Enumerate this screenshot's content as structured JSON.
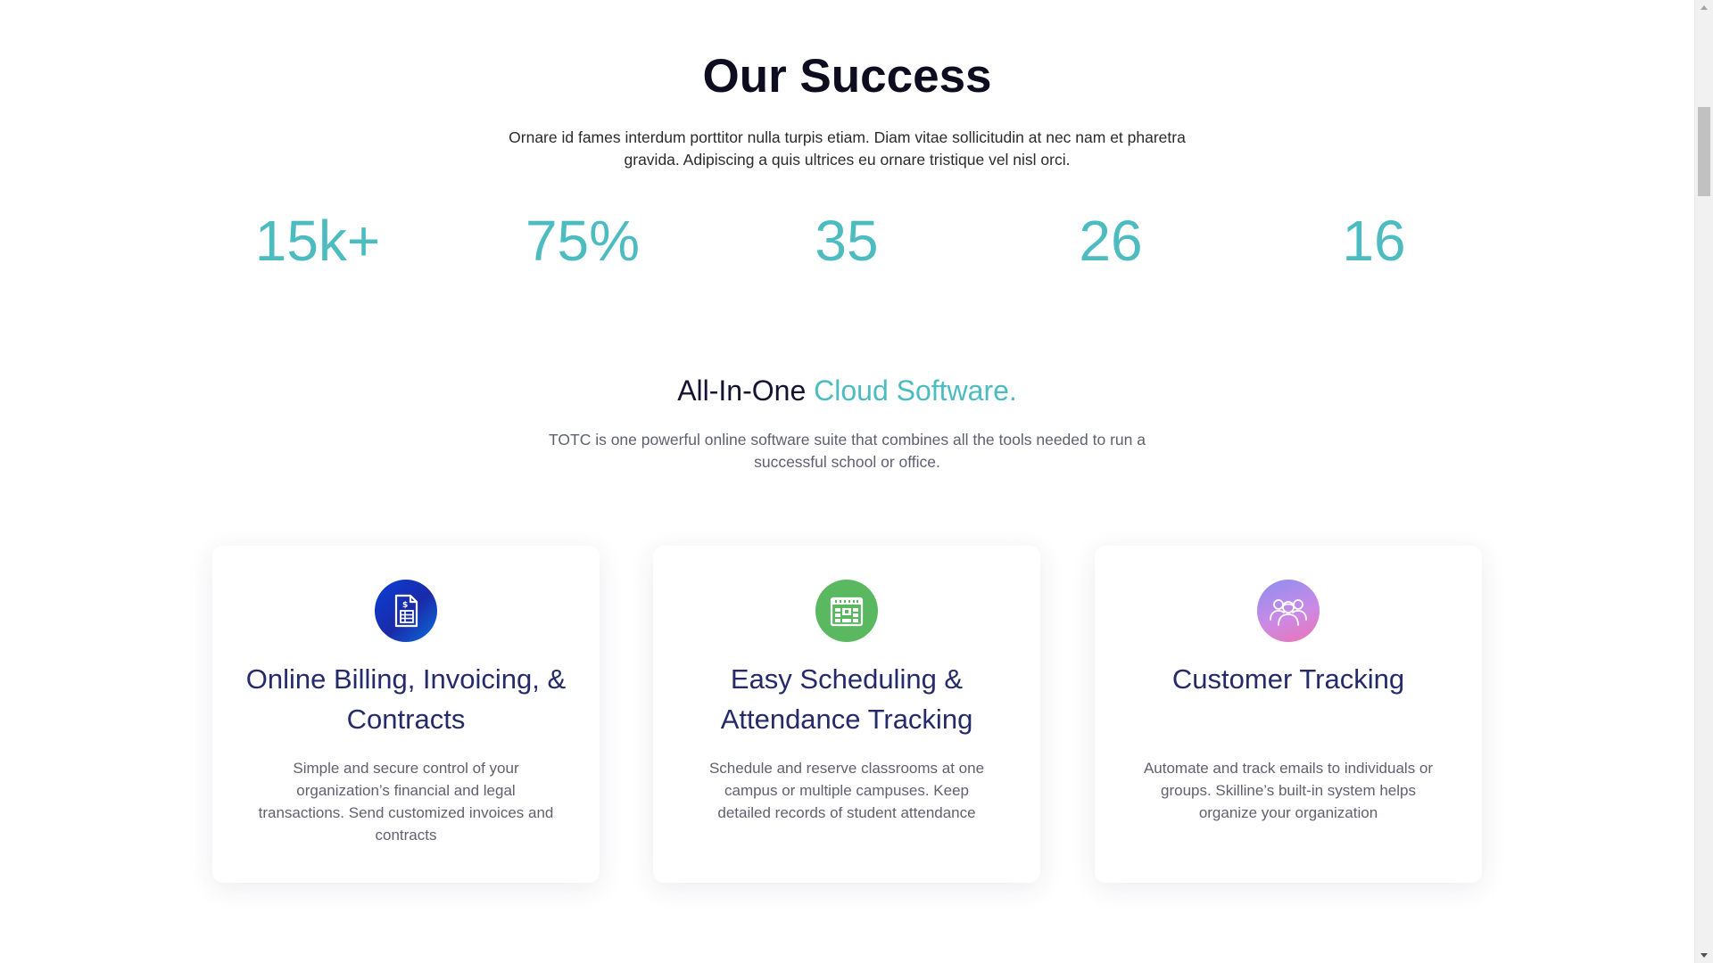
{
  "success": {
    "title": "Our Success",
    "description": "Ornare id fames interdum porttitor nulla turpis etiam. Diam vitae sollicitudin at nec nam et pharetra gravida. Adipiscing a quis ultrices eu ornare tristique vel nisl orci.",
    "stats": [
      "15k+",
      "75%",
      "35",
      "26",
      "16"
    ]
  },
  "all_in_one": {
    "title_prefix": "All-In-One",
    "title_accent": "Cloud Software.",
    "description": "TOTC is one powerful online software suite that combines all the tools needed to run a successful school or office."
  },
  "cards": [
    {
      "icon": "billing-document-icon",
      "title": "Online Billing, Invoicing, & Contracts",
      "description": "Simple and secure control of your organization’s financial and legal transactions. Send customized invoices and contracts"
    },
    {
      "icon": "calendar-icon",
      "title": "Easy Scheduling & Attendance Tracking",
      "description": "Schedule and reserve classrooms at one campus or multiple campuses. Keep detailed records of student attendance"
    },
    {
      "icon": "users-group-icon",
      "title": "Customer Tracking",
      "description": "Automate and track emails to individuals or groups. Skilline’s built-in system helps organize your organization"
    }
  ],
  "colors": {
    "accent": "#4dbcc1",
    "heading_dark": "#0d0d1f",
    "card_title": "#252a6b",
    "icon_blue": "#1a2aa8",
    "icon_green": "#5ab860",
    "icon_gradient_start": "#8d8ef0",
    "icon_gradient_end": "#ee73b6"
  }
}
